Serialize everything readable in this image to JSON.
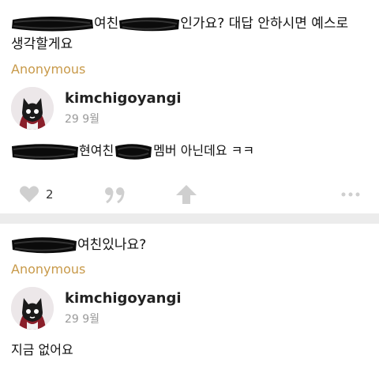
{
  "posts": [
    {
      "question_part1": "여친",
      "question_part2": "인가요? 대답 안하시면 예스로",
      "question_line2": "생각할게요",
      "asker": "Anonymous",
      "user": {
        "name": "kimchigoyangi",
        "date": "29 9월"
      },
      "answer_part1": "현여친",
      "answer_part2": "멤버 아닌데요 ㅋㅋ",
      "likes": "2"
    },
    {
      "question_part1": "여친있나요?",
      "asker": "Anonymous",
      "user": {
        "name": "kimchigoyangi",
        "date": "29 9월"
      },
      "answer": "지금 없어요"
    }
  ],
  "icons": {
    "like": "heart-icon",
    "reply": "quote-icon",
    "share": "up-arrow-icon",
    "more": "more-dots-icon"
  },
  "colors": {
    "asker": "#c89a4a",
    "icon": "#cfcfcf",
    "separator": "#ececec"
  }
}
